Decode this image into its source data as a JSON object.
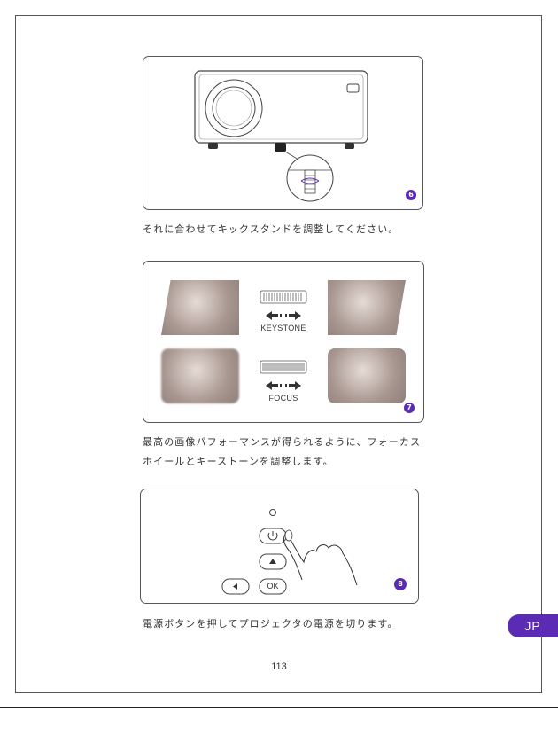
{
  "steps": [
    {
      "badge": "6",
      "caption": "それに合わせてキックスタンドを調整してください。"
    },
    {
      "badge": "7",
      "caption_lines": [
        "最高の画像パフォーマンスが得られるように、フォーカス",
        "ホイールとキーストーンを調整します。"
      ],
      "dial_labels": {
        "keystone": "KEYSTONE",
        "focus": "FOCUS"
      }
    },
    {
      "badge": "8",
      "caption": "電源ボタンを押してプロジェクタの電源を切ります。",
      "button_labels": {
        "ok": "OK"
      }
    }
  ],
  "page_number": "113",
  "language_tab": "JP",
  "colors": {
    "accent": "#5b2bb5",
    "line": "#555555"
  }
}
